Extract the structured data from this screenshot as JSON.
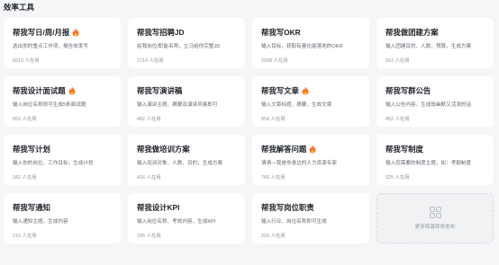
{
  "section": {
    "title": "效率工具"
  },
  "cards": [
    {
      "title": "帮我写日/周/月报",
      "hot": true,
      "desc": "选出你的重点工作项，报告效率写",
      "users": "6013 人在用"
    },
    {
      "title": "帮我写招聘JD",
      "hot": false,
      "desc": "给我岗位/职能名称，立马给你完整JD",
      "users": "2714 人在用"
    },
    {
      "title": "帮我写OKR",
      "hot": false,
      "desc": "输入目标，获取有量化能落地的OKR",
      "users": "2508 人在用"
    },
    {
      "title": "帮我做团建方案",
      "hot": false,
      "desc": "输入团建目的、人数、预算，生成方案",
      "users": "551 人在用"
    },
    {
      "title": "帮我设计面试题",
      "hot": true,
      "desc": "输入岗位名称即可生成5条面试题",
      "users": "652 人在用"
    },
    {
      "title": "帮我写演讲稿",
      "hot": false,
      "desc": "输入演讲主题、摘要及演讲风格即可",
      "users": "482 人在用"
    },
    {
      "title": "帮我写文章",
      "hot": true,
      "desc": "输入文章标题、摘要，生成文章",
      "users": "854 人在用"
    },
    {
      "title": "帮我写群公告",
      "hot": false,
      "desc": "输入公告内容，生成既幽默又活泼的话",
      "users": "452 人在用"
    },
    {
      "title": "帮我写计划",
      "hot": false,
      "desc": "输入你的岗位、工作目标，生成计划",
      "users": "342 人在用"
    },
    {
      "title": "帮我做培训方案",
      "hot": false,
      "desc": "输入培训对象、人数、目的，生成方案",
      "users": "416 人在用"
    },
    {
      "title": "帮我解答问题",
      "hot": true,
      "desc": "清清—我是你身边的人力资源专家",
      "users": "766 人在用"
    },
    {
      "title": "帮我写制度",
      "hot": false,
      "desc": "输入您需要的制度主题，如：考勤制度",
      "users": "325 人在用"
    },
    {
      "title": "帮我写通知",
      "hot": false,
      "desc": "输入通知主题，生成内容",
      "users": "210 人在用"
    },
    {
      "title": "帮我设计KPI",
      "hot": false,
      "desc": "输入岗位名称、考核内容，生成KPI",
      "users": "206 人在用"
    },
    {
      "title": "帮我写岗位职责",
      "hot": false,
      "desc": "输入行业、岗位名称即可生成",
      "users": "203 人在用"
    }
  ],
  "placeholder": {
    "text": "更多惊喜即将发布",
    "icon": "grid-icon"
  },
  "colors": {
    "flame": "#ff6b1a",
    "flame_inner": "#ffc23d",
    "card_bg": "#ffffff",
    "page_bg": "#f5f6f8"
  }
}
